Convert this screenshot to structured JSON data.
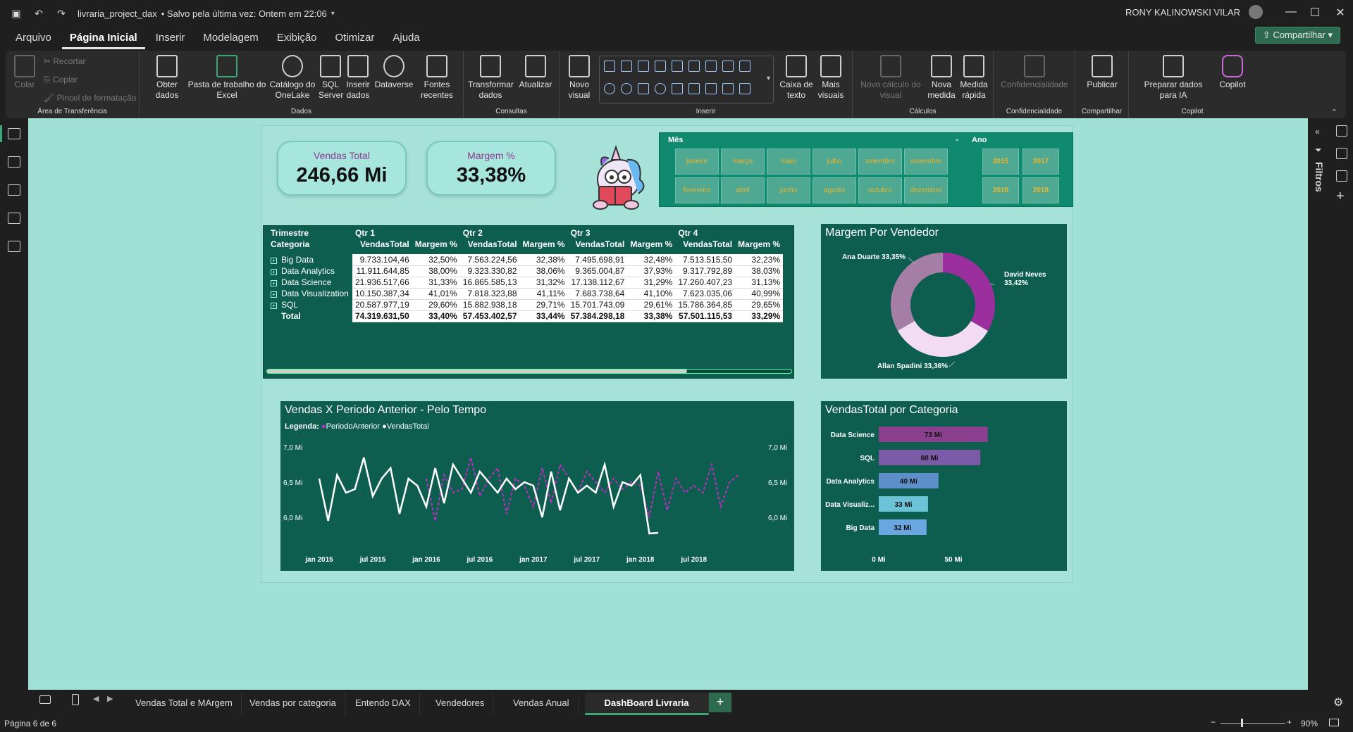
{
  "titlebar": {
    "doc": "livraria_project_dax",
    "saved": "• Salvo pela última vez: Ontem em 22:06",
    "user": "RONY KALINOWSKI VILAR"
  },
  "menu": [
    "Arquivo",
    "Página Inicial",
    "Inserir",
    "Modelagem",
    "Exibição",
    "Otimizar",
    "Ajuda"
  ],
  "share_label": "Compartilhar",
  "ribbon": {
    "clip": {
      "paste": "Colar",
      "cut": "Recortar",
      "copy": "Copiar",
      "format": "Pincel de formatação",
      "label": "Área de Transferência"
    },
    "dados": {
      "get": "Obter dados",
      "excel": "Pasta de trabalho do Excel",
      "onelake": "Catálogo do OneLake",
      "sql": "SQL Server",
      "insert": "Inserir dados",
      "dataverse": "Dataverse",
      "recent": "Fontes recentes",
      "label": "Dados"
    },
    "consultas": {
      "transform": "Transformar dados",
      "refresh": "Atualizar",
      "label": "Consultas"
    },
    "inserir": {
      "newvis": "Novo visual",
      "textbox": "Caixa de texto",
      "more": "Mais visuais",
      "label": "Inserir"
    },
    "calc": {
      "newcalc": "Novo cálculo do visual",
      "measure": "Nova medida",
      "quick": "Medida rápida",
      "label": "Cálculos"
    },
    "conf": {
      "sens": "Confidencialidade",
      "label": "Confidencialidade"
    },
    "share": {
      "publish": "Publicar",
      "label": "Compartilhar"
    },
    "copilot": {
      "prep": "Preparar dados para IA",
      "copilot": "Copilot",
      "label": "Copilot"
    }
  },
  "filters_label": "Filtros",
  "kpis": [
    {
      "label": "Vendas Total",
      "value": "246,66 Mi"
    },
    {
      "label": "Margem %",
      "value": "33,38%"
    }
  ],
  "slicer": {
    "month_title": "Mês",
    "year_title": "Ano",
    "months": [
      "janeiro",
      "março",
      "maio",
      "julho",
      "setembro",
      "novembro",
      "fevereiro",
      "abril",
      "junho",
      "agosto",
      "outubro",
      "dezembro"
    ],
    "years": [
      "2015",
      "2017",
      "2016",
      "2018"
    ]
  },
  "matrix": {
    "h1": [
      "Trimestre",
      "Qtr 1",
      "Qtr 2",
      "Qtr 3",
      "Qtr 4"
    ],
    "h2": [
      "Categoria",
      "VendasTotal",
      "Margem %",
      "VendasTotal",
      "Margem %",
      "VendasTotal",
      "Margem %",
      "VendasTotal",
      "Margem %"
    ],
    "rows": [
      [
        "Big Data",
        "9.733.104,46",
        "32,50%",
        "7.563.224,56",
        "32,38%",
        "7.495.698,91",
        "32,48%",
        "7.513.515,50",
        "32,23%"
      ],
      [
        "Data Analytics",
        "11.911.644,85",
        "38,00%",
        "9.323.330,82",
        "38,06%",
        "9.365.004,87",
        "37,93%",
        "9.317.792,89",
        "38,03%"
      ],
      [
        "Data Science",
        "21.936.517,66",
        "31,33%",
        "16.865.585,13",
        "31,32%",
        "17.138.112,67",
        "31,29%",
        "17.260.407,23",
        "31,13%"
      ],
      [
        "Data Visualization",
        "10.150.387,34",
        "41,01%",
        "7.818.323,88",
        "41,11%",
        "7.683.738,64",
        "41,10%",
        "7.623.035,06",
        "40,99%"
      ],
      [
        "SQL",
        "20.587.977,19",
        "29,60%",
        "15.882.938,18",
        "29,71%",
        "15.701.743,09",
        "29,61%",
        "15.786.364,85",
        "29,65%"
      ]
    ],
    "total": [
      "Total",
      "74.319.631,50",
      "33,40%",
      "57.453.402,57",
      "33,44%",
      "57.384.298,18",
      "33,38%",
      "57.501.115,53",
      "33,29%"
    ]
  },
  "donut": {
    "title": "Margem Por Vendedor",
    "slices": [
      {
        "name": "David Neves",
        "value": 33.42,
        "label": "David Neves 33,42%",
        "color": "#9b2f9e"
      },
      {
        "name": "Allan Spadini",
        "value": 33.36,
        "label": "Allan Spadini 33,36%",
        "color": "#f3dcf3"
      },
      {
        "name": "Ana Duarte",
        "value": 33.35,
        "label": "Ana Duarte 33,35%",
        "color": "#a47ea4"
      }
    ]
  },
  "line": {
    "title": "Vendas X Periodo Anterior - Pelo Tempo",
    "legend_title": "Legenda:",
    "series_names": [
      "PeriodoAnterior",
      "VendasTotal"
    ],
    "yticks": [
      "7,0 Mi",
      "6,5 Mi",
      "6,0 Mi"
    ],
    "xticks": [
      "jan 2015",
      "jul 2015",
      "jan 2016",
      "jul 2016",
      "jan 2017",
      "jul 2017",
      "jan 2018",
      "jul 2018"
    ]
  },
  "chart_data": [
    {
      "type": "line",
      "title": "Vendas X Periodo Anterior - Pelo Tempo",
      "ylim": [
        5.75,
        7.1
      ],
      "xlabel": "",
      "ylabel": "",
      "x": [
        "jan 2015",
        "fev 2015",
        "mar 2015",
        "abr 2015",
        "mai 2015",
        "jun 2015",
        "jul 2015",
        "ago 2015",
        "set 2015",
        "out 2015",
        "nov 2015",
        "dez 2015",
        "jan 2016",
        "fev 2016",
        "mar 2016",
        "abr 2016",
        "mai 2016",
        "jun 2016",
        "jul 2016",
        "ago 2016",
        "set 2016",
        "out 2016",
        "nov 2016",
        "dez 2016",
        "jan 2017",
        "fev 2017",
        "mar 2017",
        "abr 2017",
        "mai 2017",
        "jun 2017",
        "jul 2017",
        "ago 2017",
        "set 2017",
        "out 2017",
        "nov 2017",
        "dez 2017",
        "jan 2018",
        "fev 2018",
        "mar 2018",
        "abr 2018",
        "mai 2018",
        "jun 2018",
        "jul 2018",
        "ago 2018",
        "set 2018",
        "out 2018",
        "nov 2018",
        "dez 2018"
      ],
      "series": [
        {
          "name": "VendasTotal",
          "values": [
            6.55,
            5.95,
            6.6,
            6.35,
            6.4,
            6.85,
            6.3,
            6.55,
            6.7,
            6.05,
            6.55,
            6.45,
            6.15,
            6.7,
            6.2,
            6.75,
            6.55,
            6.35,
            6.65,
            6.5,
            6.35,
            6.55,
            6.4,
            6.5,
            6.45,
            6.0,
            6.65,
            6.1,
            6.55,
            6.35,
            6.45,
            6.35,
            6.75,
            6.15,
            6.5,
            6.45,
            6.6,
            5.77,
            5.78,
            null,
            null,
            null,
            null,
            null,
            null,
            null,
            null,
            null
          ]
        },
        {
          "name": "PeriodoAnterior",
          "values": [
            null,
            null,
            null,
            null,
            null,
            null,
            null,
            null,
            null,
            null,
            null,
            null,
            6.55,
            5.95,
            6.6,
            6.35,
            6.4,
            6.85,
            6.3,
            6.55,
            6.7,
            6.05,
            6.55,
            6.45,
            6.15,
            6.7,
            6.2,
            6.75,
            6.55,
            6.35,
            6.65,
            6.5,
            6.35,
            6.55,
            6.4,
            6.5,
            6.45,
            6.0,
            6.65,
            6.1,
            6.55,
            6.35,
            6.45,
            6.35,
            6.75,
            6.15,
            6.5,
            6.6
          ]
        }
      ]
    },
    {
      "type": "bar",
      "title": "VendasTotal por Categoria",
      "categories": [
        "Data Science",
        "SQL",
        "Data Analytics",
        "Data Visualiz...",
        "Big Data"
      ],
      "values": [
        73,
        68,
        40,
        33,
        32
      ],
      "value_labels": [
        "73 Mi",
        "68 Mi",
        "40 Mi",
        "33 Mi",
        "32 Mi"
      ],
      "xticks": [
        "0 Mi",
        "50 Mi"
      ],
      "xlim": [
        0,
        100
      ],
      "colors": [
        "#8b3f8f",
        "#7b5aa8",
        "#5f8fc8",
        "#6cc2d6",
        "#6aa6e0"
      ]
    },
    {
      "type": "pie",
      "title": "Margem Por Vendedor",
      "categories": [
        "David Neves",
        "Allan Spadini",
        "Ana Duarte"
      ],
      "values": [
        33.42,
        33.36,
        33.35
      ]
    }
  ],
  "tabs": [
    "Vendas Total e MArgem",
    "Vendas por categoria",
    "Entendo DAX",
    "Vendedores",
    "Vendas Anual",
    "DashBoard Livraria"
  ],
  "status": {
    "page": "Página 6 de 6",
    "zoom": "90%"
  }
}
